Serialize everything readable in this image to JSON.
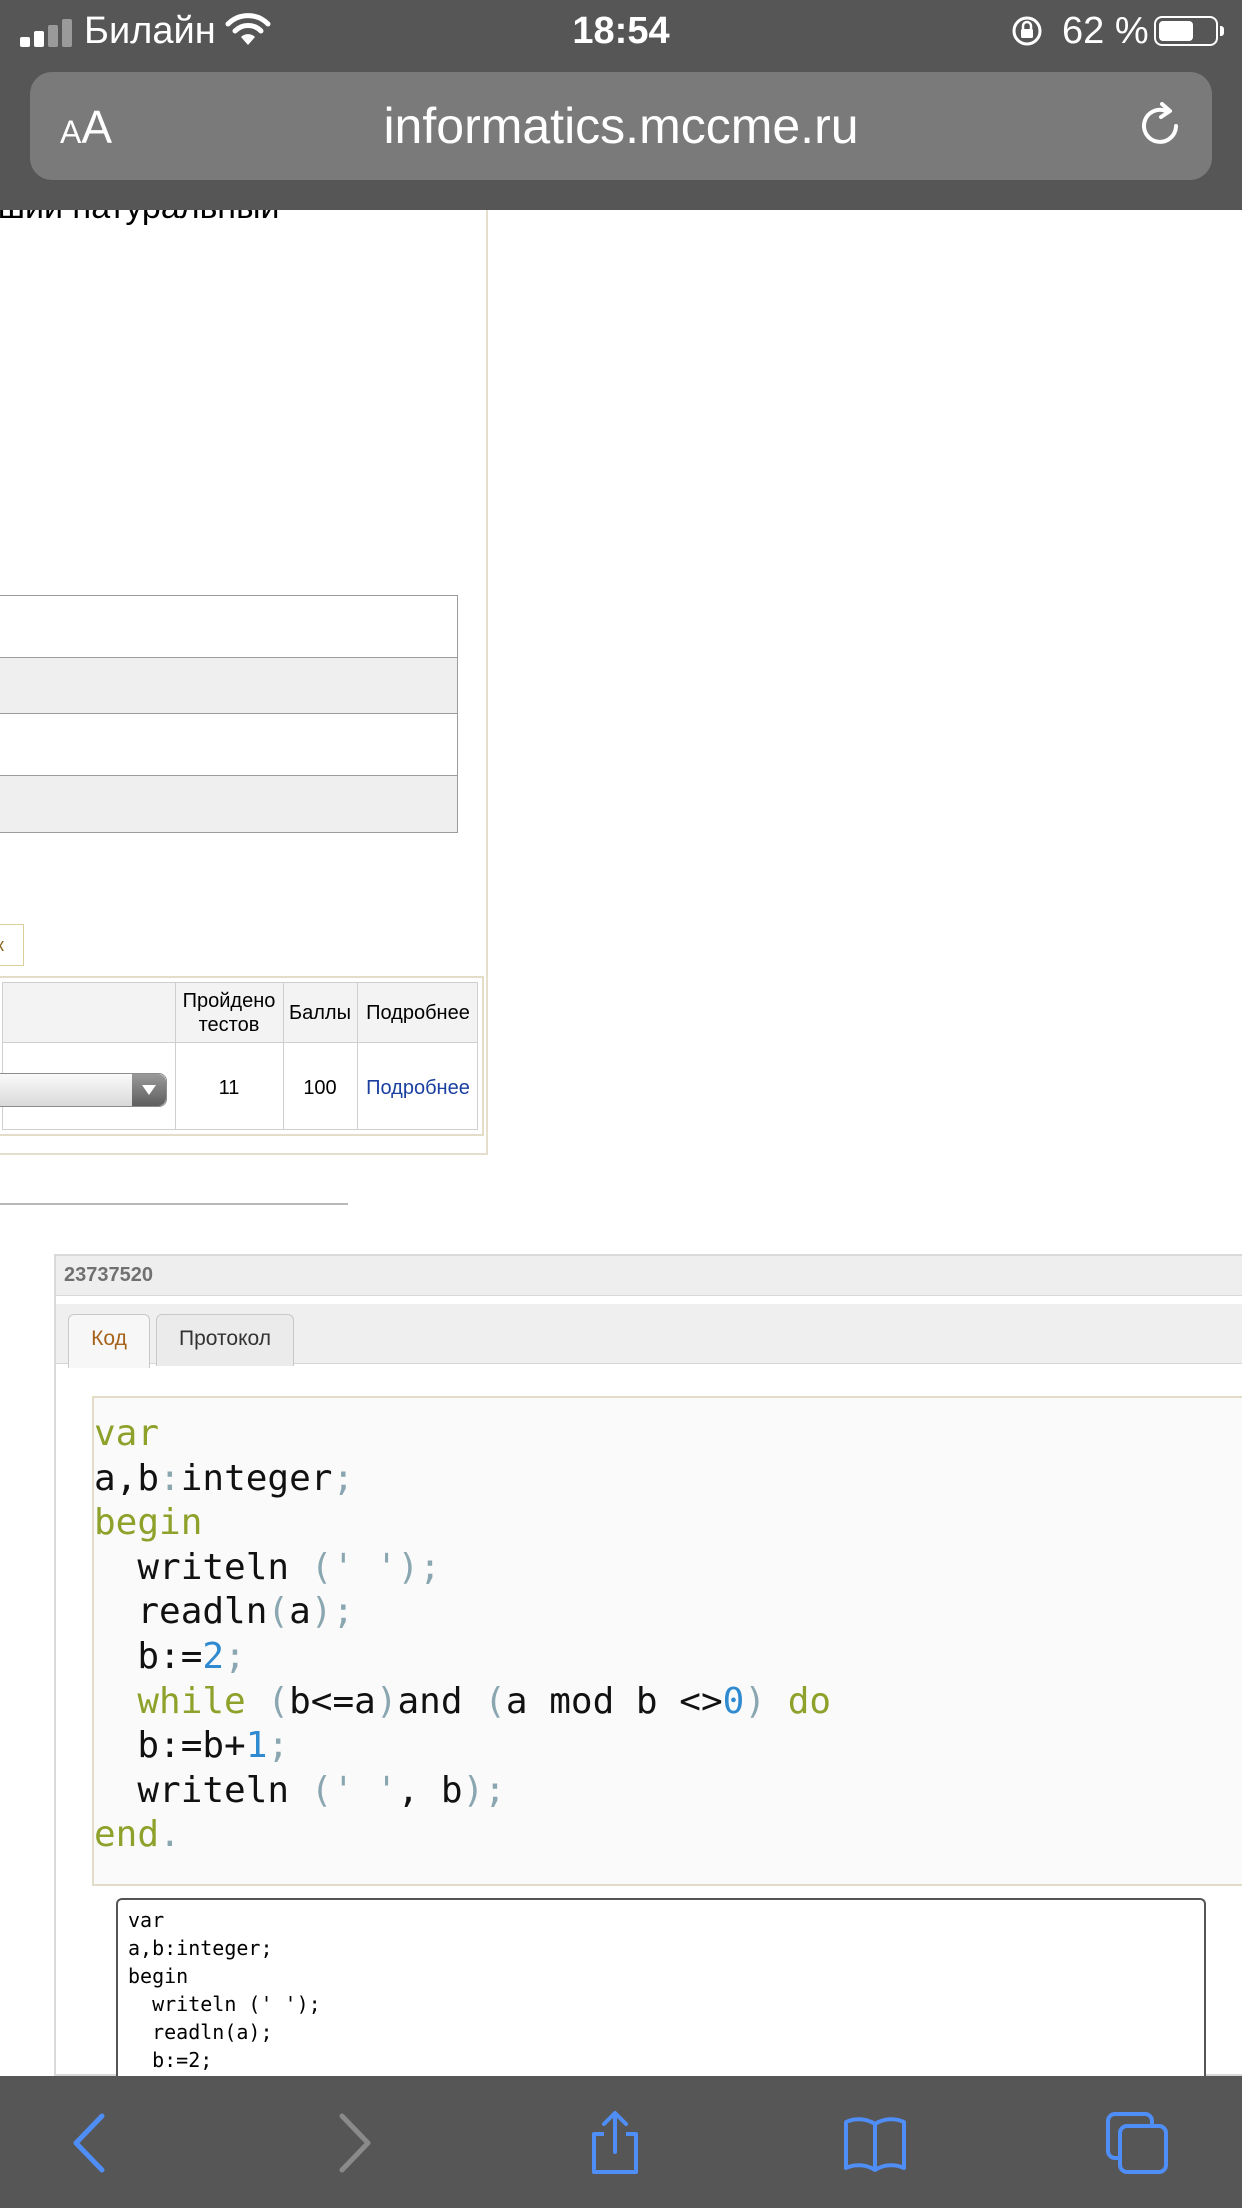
{
  "status_bar": {
    "carrier": "Билайн",
    "time": "18:54",
    "battery_percent": "62 %",
    "battery_level": 0.62,
    "icons": [
      "signal-icon",
      "wifi-icon",
      "orientation-lock-icon",
      "battery-icon"
    ]
  },
  "url_bar": {
    "text_size_button_small": "A",
    "text_size_button_large": "A",
    "url": "informatics.mccme.ru",
    "reload_icon": "reload-icon"
  },
  "page": {
    "cut_text": "ьший натуральный",
    "small_button_label": "к",
    "submission_table": {
      "headers": {
        "tests_passed": "Пройдено тестов",
        "score": "Баллы",
        "details": "Подробнее"
      },
      "row": {
        "tests_passed": "11",
        "score": "100",
        "details_link": "Подробнее"
      }
    },
    "submission": {
      "id": "23737520",
      "tabs": [
        "Код",
        "Протокол"
      ],
      "active_tab": "Код",
      "code_area_lines": [
        "var",
        "a,b:integer;",
        "begin",
        "  writeln (' ');",
        "  readln(a);",
        "  b:=2;"
      ]
    }
  },
  "toolbar": {
    "icons": [
      "back-icon",
      "forward-icon",
      "share-icon",
      "bookmarks-icon",
      "tabs-icon"
    ],
    "accent": "#4f8ef7",
    "disabled": "#8a8a8a"
  }
}
